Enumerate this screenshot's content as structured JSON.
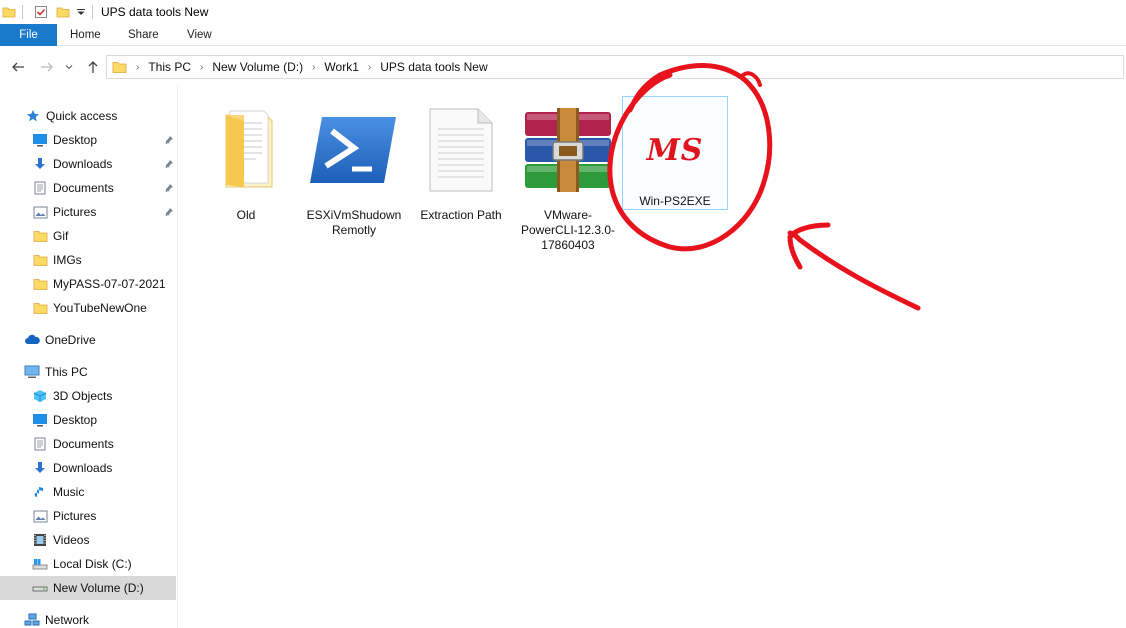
{
  "window": {
    "title": "UPS data tools New"
  },
  "ribbon": {
    "tabs": [
      "File",
      "Home",
      "Share",
      "View"
    ]
  },
  "address": {
    "crumbs": [
      "This PC",
      "New Volume (D:)",
      "Work1",
      "UPS data tools New"
    ]
  },
  "nav": {
    "quick_access": "Quick access",
    "quick_items": [
      {
        "label": "Desktop",
        "icon": "desktop-icon",
        "pinned": true
      },
      {
        "label": "Downloads",
        "icon": "downloads-icon",
        "pinned": true
      },
      {
        "label": "Documents",
        "icon": "documents-icon",
        "pinned": true
      },
      {
        "label": "Pictures",
        "icon": "pictures-icon",
        "pinned": true
      },
      {
        "label": "Gif",
        "icon": "folder-icon",
        "pinned": false
      },
      {
        "label": "IMGs",
        "icon": "folder-icon",
        "pinned": false
      },
      {
        "label": "MyPASS-07-07-2021",
        "icon": "folder-icon",
        "pinned": false
      },
      {
        "label": "YouTubeNewOne",
        "icon": "folder-icon",
        "pinned": false
      }
    ],
    "onedrive": "OneDrive",
    "this_pc": "This PC",
    "pc_items": [
      {
        "label": "3D Objects",
        "icon": "3d-objects-icon"
      },
      {
        "label": "Desktop",
        "icon": "desktop-icon"
      },
      {
        "label": "Documents",
        "icon": "documents-icon"
      },
      {
        "label": "Downloads",
        "icon": "downloads-icon"
      },
      {
        "label": "Music",
        "icon": "music-icon"
      },
      {
        "label": "Pictures",
        "icon": "pictures-icon"
      },
      {
        "label": "Videos",
        "icon": "videos-icon"
      },
      {
        "label": "Local Disk (C:)",
        "icon": "local-disk-icon"
      },
      {
        "label": "New Volume (D:)",
        "icon": "drive-icon"
      }
    ],
    "network": "Network"
  },
  "files": [
    {
      "name": "Old",
      "icon": "folder-icon"
    },
    {
      "name": "ESXiVmShudown Remotly",
      "icon": "powershell-icon"
    },
    {
      "name": "Extraction Path",
      "icon": "text-file-icon"
    },
    {
      "name": "VMware-PowerCLI-12.3.0-17860403",
      "icon": "winrar-archive-icon"
    },
    {
      "name": "Win-PS2EXE",
      "icon": "ms-app-icon",
      "logo_text": "MS"
    }
  ],
  "colors": {
    "accent": "#1979ca",
    "annotation": "#e8121c",
    "folder": "#ffd966"
  }
}
